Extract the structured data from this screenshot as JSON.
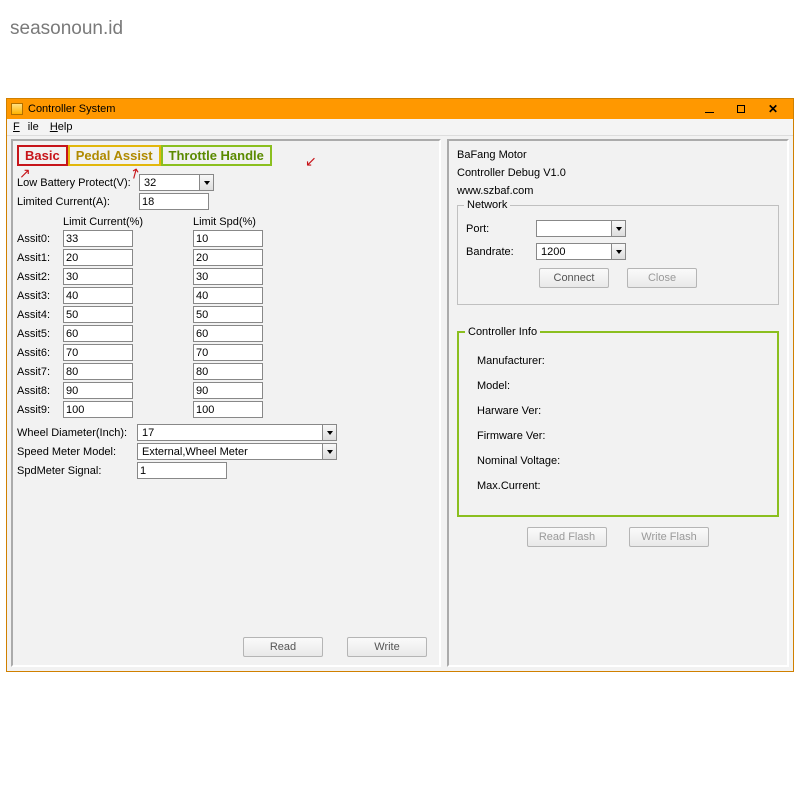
{
  "watermark": "seasonoun.id",
  "window": {
    "title": "Controller System"
  },
  "menu": {
    "file": "File",
    "help": "Help"
  },
  "tabs": {
    "basic": "Basic",
    "pedal": "Pedal Assist",
    "throttle": "Throttle Handle"
  },
  "basic": {
    "low_battery_label": "Low Battery Protect(V):",
    "low_battery_value": "32",
    "limited_current_label": "Limited Current(A):",
    "limited_current_value": "18",
    "col_limit_current": "Limit Current(%)",
    "col_limit_spd": "Limit Spd(%)",
    "assist": [
      {
        "label": "Assit0:",
        "cur": "33",
        "spd": "10"
      },
      {
        "label": "Assit1:",
        "cur": "20",
        "spd": "20"
      },
      {
        "label": "Assit2:",
        "cur": "30",
        "spd": "30"
      },
      {
        "label": "Assit3:",
        "cur": "40",
        "spd": "40"
      },
      {
        "label": "Assit4:",
        "cur": "50",
        "spd": "50"
      },
      {
        "label": "Assit5:",
        "cur": "60",
        "spd": "60"
      },
      {
        "label": "Assit6:",
        "cur": "70",
        "spd": "70"
      },
      {
        "label": "Assit7:",
        "cur": "80",
        "spd": "80"
      },
      {
        "label": "Assit8:",
        "cur": "90",
        "spd": "90"
      },
      {
        "label": "Assit9:",
        "cur": "100",
        "spd": "100"
      }
    ],
    "wheel_diameter_label": "Wheel Diameter(Inch):",
    "wheel_diameter_value": "17",
    "speed_meter_label": "Speed Meter Model:",
    "speed_meter_value": "External,Wheel Meter",
    "spd_signal_label": "SpdMeter Signal:",
    "spd_signal_value": "1",
    "read_btn": "Read",
    "write_btn": "Write"
  },
  "right": {
    "brand": "BaFang Motor",
    "version": "Controller Debug V1.0",
    "url": "www.szbaf.com",
    "network": {
      "legend": "Network",
      "port_label": "Port:",
      "port_value": "",
      "bandrate_label": "Bandrate:",
      "bandrate_value": "1200",
      "connect_btn": "Connect",
      "close_btn": "Close"
    },
    "controller_info": {
      "legend": "Controller Info",
      "items": [
        "Manufacturer:",
        "Model:",
        "Harware Ver:",
        "Firmware Ver:",
        "Nominal Voltage:",
        "Max.Current:"
      ]
    },
    "read_flash_btn": "Read Flash",
    "write_flash_btn": "Write Flash"
  }
}
